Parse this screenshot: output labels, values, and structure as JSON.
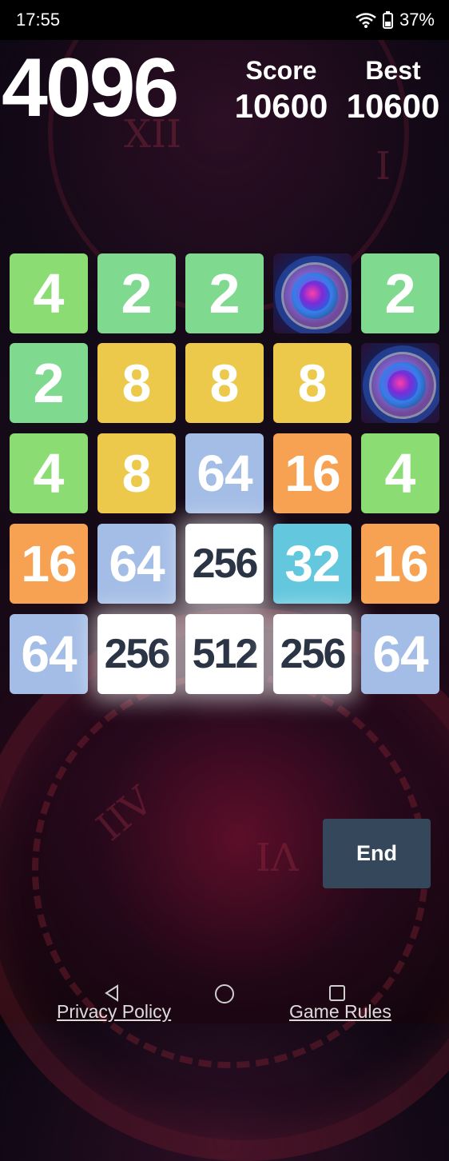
{
  "status_bar": {
    "time": "17:55",
    "battery": "37%"
  },
  "header": {
    "title": "4096",
    "score_label": "Score",
    "score_value": "10600",
    "best_label": "Best",
    "best_value": "10600"
  },
  "board": [
    [
      "4",
      "2",
      "2",
      "special",
      "2"
    ],
    [
      "2",
      "8",
      "8",
      "8",
      "special"
    ],
    [
      "4",
      "8",
      "64",
      "16",
      "4"
    ],
    [
      "16",
      "64",
      "256",
      "32",
      "16"
    ],
    [
      "64",
      "256",
      "512",
      "256",
      "64"
    ]
  ],
  "tile_colors": {
    "2": "#7fd98e",
    "4": "#8bdd73",
    "8": "#ecc94b",
    "16": "#f7a252",
    "32": "#63c7dd",
    "64": "#a4bde6",
    "256": "#ffffff",
    "512": "#ffffff"
  },
  "actions": {
    "end_label": "End"
  },
  "footer": {
    "privacy_label": "Privacy Policy",
    "rules_label": "Game Rules"
  },
  "icons": [
    "wifi-icon",
    "battery-icon",
    "back-icon",
    "home-icon",
    "recents-icon",
    "time-spiral-icon"
  ]
}
